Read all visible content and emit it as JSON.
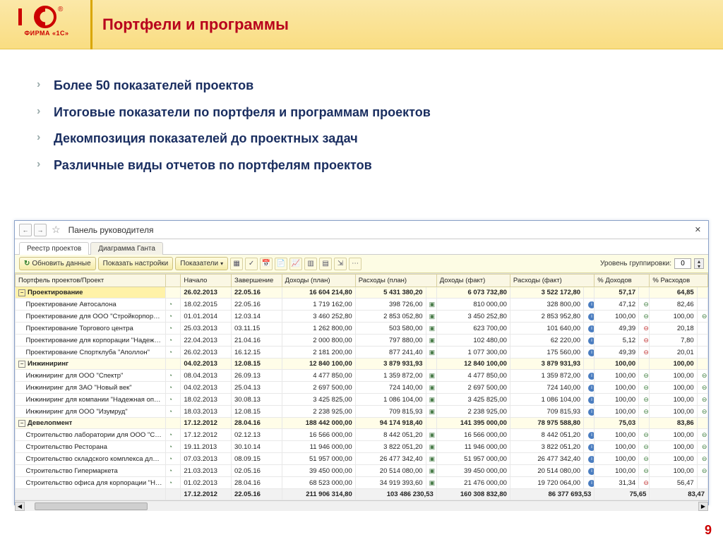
{
  "logo_caption": "ФИРМА «1С»",
  "slide_title": "Портфели и программы",
  "bullets": [
    "Более 50 показателей проектов",
    "Итоговые показатели по портфеля и программам проектов",
    "Декомпозиция показателей до проектных задач",
    "Различные виды отчетов по портфелям проектов"
  ],
  "window": {
    "title": "Панель руководителя",
    "tabs": [
      {
        "label": "Реестр проектов",
        "active": true
      },
      {
        "label": "Диаграмма Ганта",
        "active": false
      }
    ],
    "toolbar": {
      "refresh": "Обновить данные",
      "show_settings": "Показать настройки",
      "indicators": "Показатели",
      "grouping_label": "Уровень группировки:",
      "grouping_value": "0"
    },
    "columns": [
      "Портфель проектов/Проект",
      "",
      "Начало",
      "Завершение",
      "Доходы (план)",
      "Расходы (план)",
      "Доходы (факт)",
      "Расходы (факт)",
      "% Доходов",
      "% Расходов"
    ],
    "rows": [
      {
        "type": "group",
        "ind": "-",
        "name": "Проектирование",
        "start": "26.02.2013",
        "end": "22.05.16",
        "dp": "16 604 214,80",
        "rp": "5 431 380,20",
        "df": "6 073 732,80",
        "rf": "3 522 172,80",
        "pd": "57,17",
        "pr": "64,85",
        "pd_ic": "",
        "pr_ic": "",
        "sel": true
      },
      {
        "type": "row",
        "name": "Проектирование Автосалона",
        "start": "18.02.2015",
        "end": "22.05.16",
        "dp": "1 719 162,00",
        "rp": "398 726,00",
        "df": "810 000,00",
        "rf": "328 800,00",
        "pd": "47,12",
        "pd_ic": "g",
        "pr": "82,46",
        "pr_ic": ""
      },
      {
        "type": "row",
        "name": "Проектирование для ООО \"Стройкорпорац…",
        "start": "01.01.2014",
        "end": "12.03.14",
        "dp": "3 460 252,80",
        "rp": "2 853 052,80",
        "df": "3 450 252,80",
        "rf": "2 853 952,80",
        "pd": "100,00",
        "pd_ic": "g",
        "pr": "100,00",
        "pr_ic": "g"
      },
      {
        "type": "row",
        "name": "Проектирование Торгового центра",
        "start": "25.03.2013",
        "end": "03.11.15",
        "dp": "1 262 800,00",
        "rp": "503 580,00",
        "df": "623 700,00",
        "rf": "101 640,00",
        "pd": "49,39",
        "pd_ic": "r",
        "pr": "20,18",
        "pr_ic": ""
      },
      {
        "type": "row",
        "name": "Проектирование для корпорации \"Надежн…",
        "start": "22.04.2013",
        "end": "21.04.16",
        "dp": "2 000 800,00",
        "rp": "797 880,00",
        "df": "102 480,00",
        "rf": "62 220,00",
        "pd": "5,12",
        "pd_ic": "r",
        "pr": "7,80",
        "pr_ic": ""
      },
      {
        "type": "row",
        "name": "Проектирование Спортклуба \"Аполлон\"",
        "start": "26.02.2013",
        "end": "16.12.15",
        "dp": "2 181 200,00",
        "rp": "877 241,40",
        "df": "1 077 300,00",
        "rf": "175 560,00",
        "pd": "49,39",
        "pd_ic": "r",
        "pr": "20,01",
        "pr_ic": ""
      },
      {
        "type": "group",
        "ind": "-",
        "name": "Инжиниринг",
        "start": "04.02.2013",
        "end": "12.08.15",
        "dp": "12 840 100,00",
        "rp": "3 879 931,93",
        "df": "12 840 100,00",
        "rf": "3 879 931,93",
        "pd": "100,00",
        "pd_ic": "",
        "pr": "100,00",
        "pr_ic": ""
      },
      {
        "type": "row",
        "name": "Инжиниринг для ООО \"Спектр\"",
        "start": "08.04.2013",
        "end": "26.09.13",
        "dp": "4 477 850,00",
        "rp": "1 359 872,00",
        "df": "4 477 850,00",
        "rf": "1 359 872,00",
        "pd": "100,00",
        "pd_ic": "g",
        "pr": "100,00",
        "pr_ic": "g"
      },
      {
        "type": "row",
        "name": "Инжиниринг для ЗАО \"Новый век\"",
        "start": "04.02.2013",
        "end": "25.04.13",
        "dp": "2 697 500,00",
        "rp": "724 140,00",
        "df": "2 697 500,00",
        "rf": "724 140,00",
        "pd": "100,00",
        "pd_ic": "g",
        "pr": "100,00",
        "pr_ic": "g"
      },
      {
        "type": "row",
        "name": "Инжиниринг для компании \"Надежная опо…",
        "start": "18.02.2013",
        "end": "30.08.13",
        "dp": "3 425 825,00",
        "rp": "1 086 104,00",
        "df": "3 425 825,00",
        "rf": "1 086 104,00",
        "pd": "100,00",
        "pd_ic": "g",
        "pr": "100,00",
        "pr_ic": "g"
      },
      {
        "type": "row",
        "name": "Инжиниринг для ООО \"Изумруд\"",
        "start": "18.03.2013",
        "end": "12.08.15",
        "dp": "2 238 925,00",
        "rp": "709 815,93",
        "df": "2 238 925,00",
        "rf": "709 815,93",
        "pd": "100,00",
        "pd_ic": "g",
        "pr": "100,00",
        "pr_ic": "g"
      },
      {
        "type": "group",
        "ind": "-",
        "name": "Девелопмент",
        "start": "17.12.2012",
        "end": "28.04.16",
        "dp": "188 442 000,00",
        "rp": "94 174 918,40",
        "df": "141 395 000,00",
        "rf": "78 975 588,80",
        "pd": "75,03",
        "pd_ic": "",
        "pr": "83,86",
        "pr_ic": ""
      },
      {
        "type": "row",
        "name": "Строительство лаборатории для ООО \"Спе…",
        "start": "17.12.2012",
        "end": "02.12.13",
        "dp": "16 566 000,00",
        "rp": "8 442 051,20",
        "df": "16 566 000,00",
        "rf": "8 442 051,20",
        "pd": "100,00",
        "pd_ic": "g",
        "pr": "100,00",
        "pr_ic": "g"
      },
      {
        "type": "row",
        "name": "Строительство Ресторана",
        "start": "19.11.2013",
        "end": "30.10.14",
        "dp": "11 946 000,00",
        "rp": "3 822 051,20",
        "df": "11 946 000,00",
        "rf": "3 822 051,20",
        "pd": "100,00",
        "pd_ic": "g",
        "pr": "100,00",
        "pr_ic": "g"
      },
      {
        "type": "row",
        "name": "Строительство складского комплекса для …",
        "start": "07.03.2013",
        "end": "08.09.15",
        "dp": "51 957 000,00",
        "rp": "26 477 342,40",
        "df": "51 957 000,00",
        "rf": "26 477 342,40",
        "pd": "100,00",
        "pd_ic": "g",
        "pr": "100,00",
        "pr_ic": "g"
      },
      {
        "type": "row",
        "name": "Строительство Гипермаркета",
        "start": "21.03.2013",
        "end": "02.05.16",
        "dp": "39 450 000,00",
        "rp": "20 514 080,00",
        "df": "39 450 000,00",
        "rf": "20 514 080,00",
        "pd": "100,00",
        "pd_ic": "g",
        "pr": "100,00",
        "pr_ic": "g"
      },
      {
        "type": "row",
        "name": "Строительство офиса для корпорации \"На…",
        "start": "01.02.2013",
        "end": "28.04.16",
        "dp": "68 523 000,00",
        "rp": "34 919 393,60",
        "df": "21 476 000,00",
        "rf": "19 720 064,00",
        "pd": "31,34",
        "pd_ic": "r",
        "pr": "56,47",
        "pr_ic": ""
      }
    ],
    "footer": {
      "start": "17.12.2012",
      "end": "22.05.16",
      "dp": "211 906 314,80",
      "rp": "103 486 230,53",
      "df": "160 308 832,80",
      "rf": "86 377 693,53",
      "pd": "75,65",
      "pr": "83,47"
    }
  },
  "page_number": "9"
}
